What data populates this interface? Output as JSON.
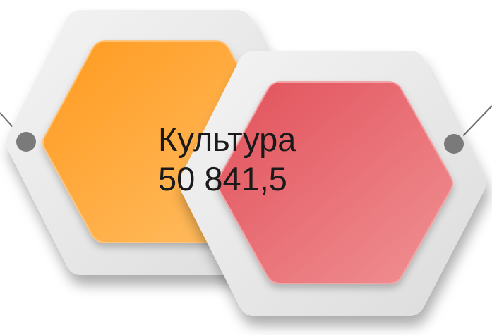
{
  "node": {
    "title": "Культура",
    "value": "50 841,5"
  },
  "colors": {
    "orange": "#ffa02b",
    "red": "#e8636a",
    "frame": "#ececec",
    "connector": "#6d6d6d"
  }
}
